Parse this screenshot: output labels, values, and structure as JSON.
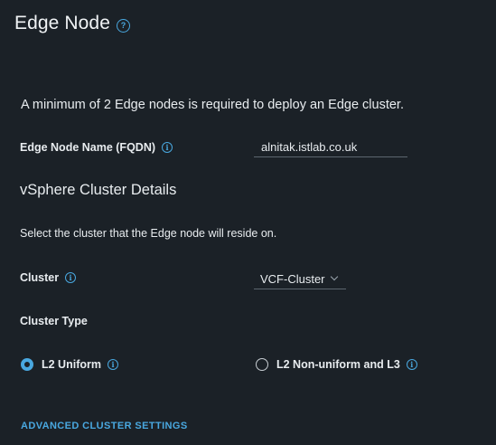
{
  "header": {
    "title": "Edge Node",
    "help_icon": "question-circle-icon"
  },
  "intro_text": "A minimum of 2 Edge nodes is required to deploy an Edge cluster.",
  "edge_node_name": {
    "label": "Edge Node Name (FQDN)",
    "info_icon": "info-icon",
    "value": "alnitak.istlab.co.uk"
  },
  "vsphere_section": {
    "title": "vSphere Cluster Details",
    "description": "Select the cluster that the Edge node will reside on."
  },
  "cluster": {
    "label": "Cluster",
    "info_icon": "info-icon",
    "selected": "VCF-Cluster",
    "chevron_icon": "chevron-down-icon"
  },
  "cluster_type": {
    "label": "Cluster Type",
    "options": [
      {
        "label": "L2 Uniform",
        "selected": true
      },
      {
        "label": "L2 Non-uniform and L3",
        "selected": false
      }
    ]
  },
  "advanced_link": "ADVANCED CLUSTER SETTINGS",
  "colors": {
    "background": "#1b2127",
    "accent": "#49a8e0",
    "text": "#e8ecef"
  }
}
